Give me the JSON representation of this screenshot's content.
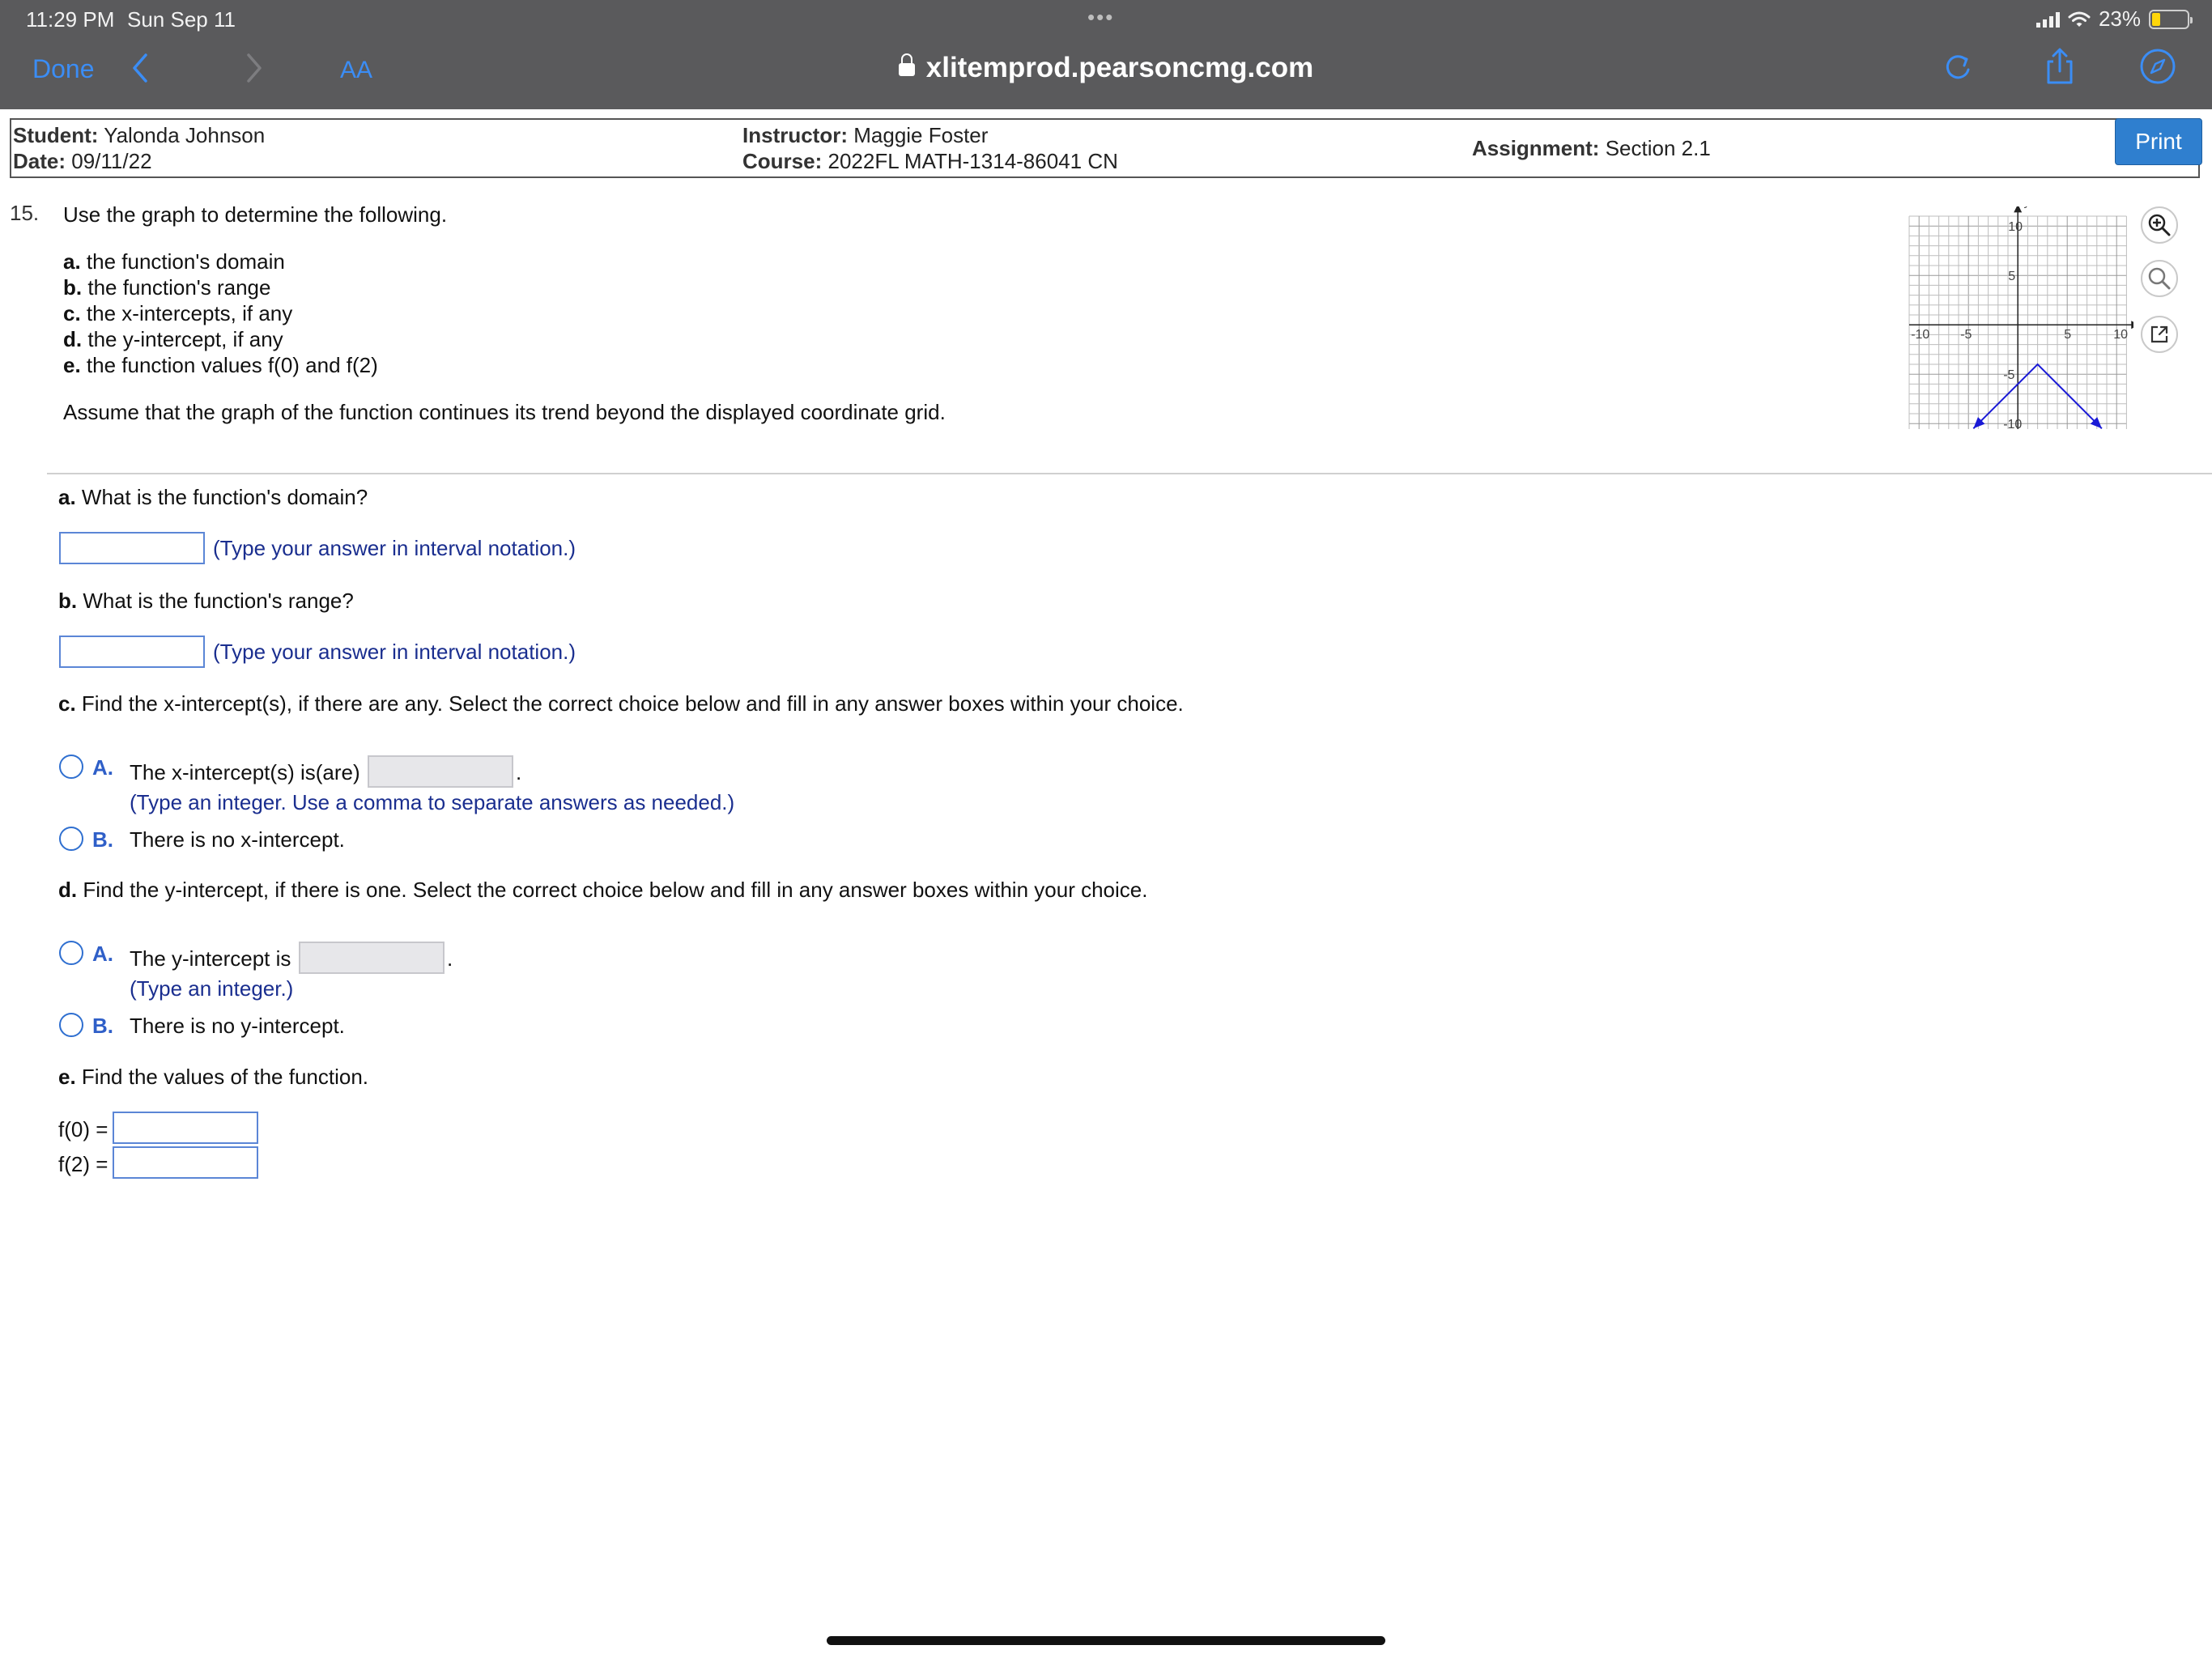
{
  "status_bar": {
    "time": "11:29 PM",
    "date": "Sun Sep 11",
    "dots": "•••",
    "battery": "23%",
    "battery_level": 0.23
  },
  "browser": {
    "done": "Done",
    "back": "‹",
    "forward": "›",
    "text_size": "AA",
    "url": "xlitemprod.pearsoncmg.com",
    "accent": "#3b8df5"
  },
  "header": {
    "student_label": "Student:",
    "student": "Yalonda Johnson",
    "date_label": "Date:",
    "date": "09/11/22",
    "instructor_label": "Instructor:",
    "instructor": "Maggie Foster",
    "course_label": "Course:",
    "course": "2022FL MATH-1314-86041 CN",
    "assignment_label": "Assignment:",
    "assignment": "Section 2.1",
    "print": "Print"
  },
  "question": {
    "number": "15.",
    "prompt": "Use the graph to determine the following.",
    "items": [
      {
        "letter": "a.",
        "text": "the function's domain"
      },
      {
        "letter": "b.",
        "text": "the function's range"
      },
      {
        "letter": "c.",
        "text": "the x-intercepts, if any"
      },
      {
        "letter": "d.",
        "text": "the y-intercept, if any"
      },
      {
        "letter": "e.",
        "text": "the function values f(0) and f(2)"
      }
    ],
    "assume": "Assume that the graph of the function continues its trend beyond the displayed coordinate grid."
  },
  "graph": {
    "x_label": "x",
    "y_label": "y",
    "ticks": {
      "neg10": "-10",
      "neg5": "-5",
      "pos5": "5",
      "pos10": "10",
      "y10": "10",
      "y5": "5",
      "yneg5": "-5",
      "yneg10": "-10"
    },
    "vertex": [
      2,
      -4
    ],
    "line_color": "#1a1ad6"
  },
  "tools": {
    "zoom_in": "zoom-in-icon",
    "zoom_out": "zoom-out-icon",
    "popout": "popout-icon"
  },
  "parts": {
    "a": {
      "letter": "a.",
      "question": "What is the function's domain?",
      "hint": "(Type your answer in interval notation.)"
    },
    "b": {
      "letter": "b.",
      "question": "What is the function's range?",
      "hint": "(Type your answer in interval notation.)"
    },
    "c": {
      "letter": "c.",
      "question": "Find the x-intercept(s), if there are any. Select the correct choice below and fill in any answer boxes within your choice.",
      "option_a_letter": "A.",
      "option_a": "The x-intercept(s) is(are)",
      "option_a_hint": "(Type an integer. Use a comma to separate answers as needed.)",
      "option_b_letter": "B.",
      "option_b": "There is no x-intercept."
    },
    "d": {
      "letter": "d.",
      "question": "Find the y-intercept, if there is one. Select the correct choice below and fill in any answer boxes within your choice.",
      "option_a_letter": "A.",
      "option_a": "The y-intercept is",
      "option_a_hint": "(Type an integer.)",
      "option_b_letter": "B.",
      "option_b": "There is no y-intercept."
    },
    "e": {
      "letter": "e.",
      "question": "Find the values of the function.",
      "f0_label": "f(0) =",
      "f2_label": "f(2) ="
    },
    "period": "."
  }
}
